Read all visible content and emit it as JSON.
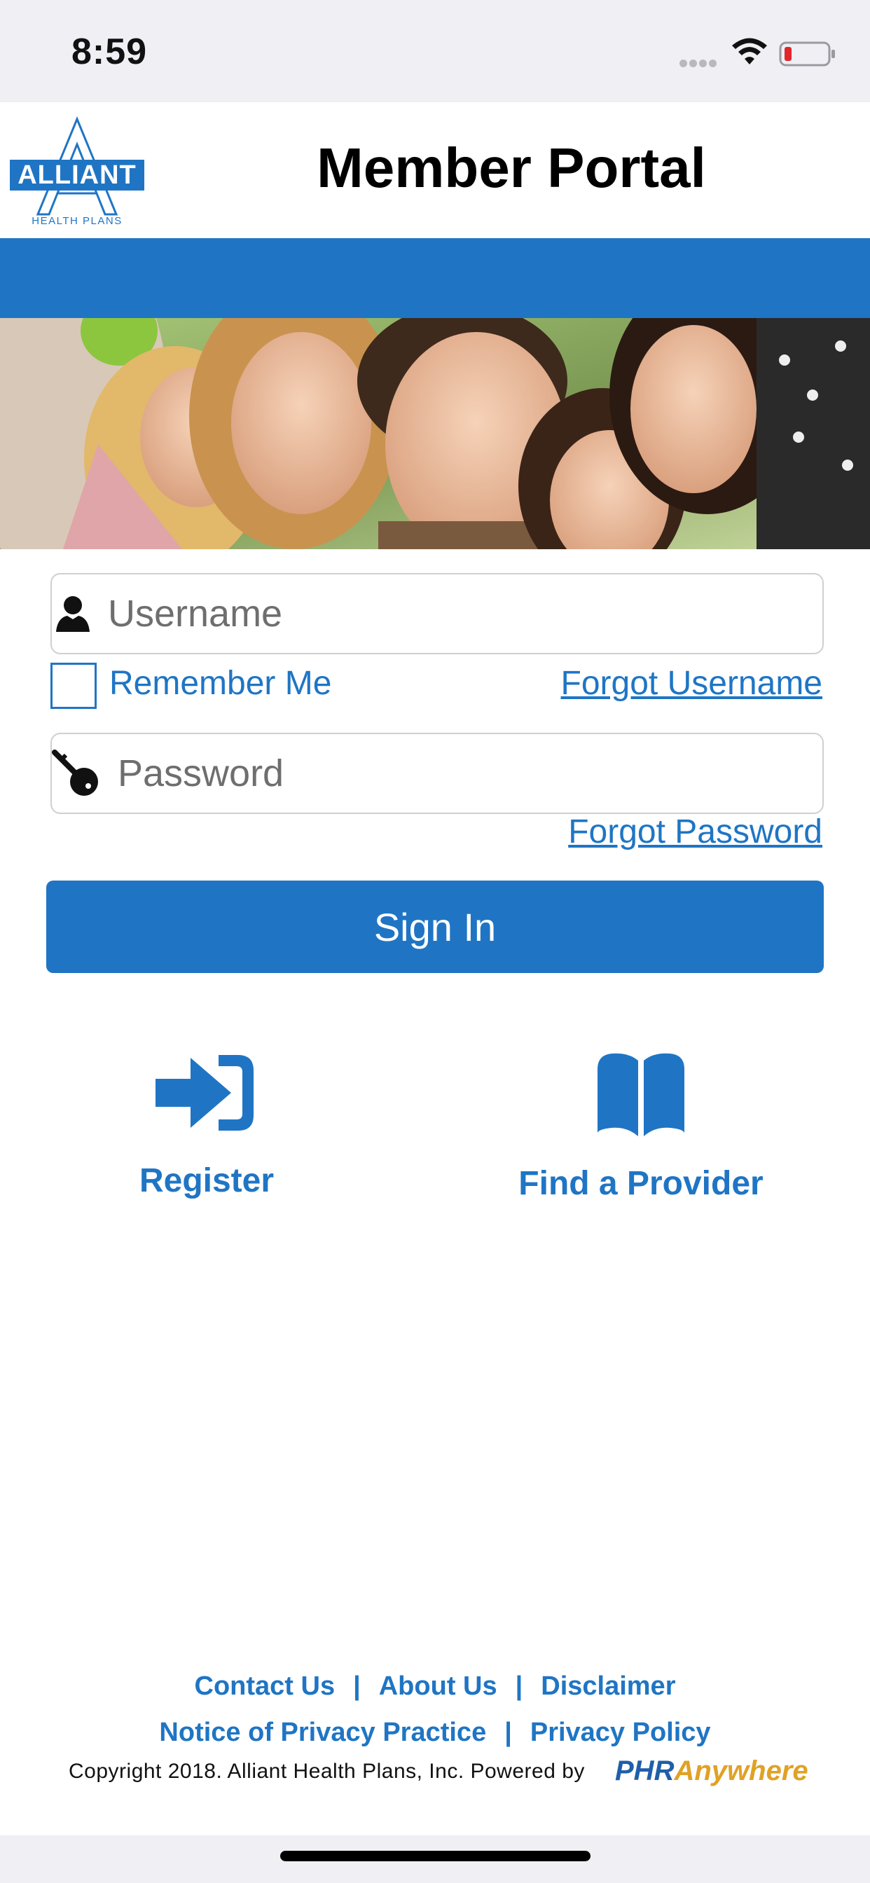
{
  "status_bar": {
    "time": "8:59",
    "icons": [
      "signal-dots-icon",
      "wifi-icon",
      "battery-low-icon"
    ],
    "battery_color": "#e0262b"
  },
  "header": {
    "logo_text": "ALLIANT",
    "logo_subtext": "HEALTH PLANS",
    "title": "Member Portal"
  },
  "colors": {
    "accent": "#1f75c4",
    "page_background": "#ffffff",
    "system_bar_background": "#efeff4"
  },
  "login": {
    "username_placeholder": "Username",
    "username_value": "",
    "remember_label": "Remember Me",
    "remember_checked": false,
    "forgot_username": "Forgot Username",
    "password_placeholder": "Password",
    "password_value": "",
    "forgot_password": "Forgot Password",
    "sign_in": "Sign In"
  },
  "actions": {
    "register_label": "Register",
    "register_icon": "sign-in-arrow-icon",
    "provider_label": "Find a Provider",
    "provider_icon": "open-book-icon"
  },
  "footer": {
    "contact": "Contact Us",
    "about": "About Us",
    "disclaimer": "Disclaimer",
    "privacy_practice": "Notice of Privacy Practice",
    "privacy_policy": "Privacy Policy",
    "separator": "|",
    "copyright": "Copyright 2018. Alliant Health Plans, Inc. Powered by",
    "powered_logo_part1": "PHR",
    "powered_logo_part2": "Anywhere"
  }
}
